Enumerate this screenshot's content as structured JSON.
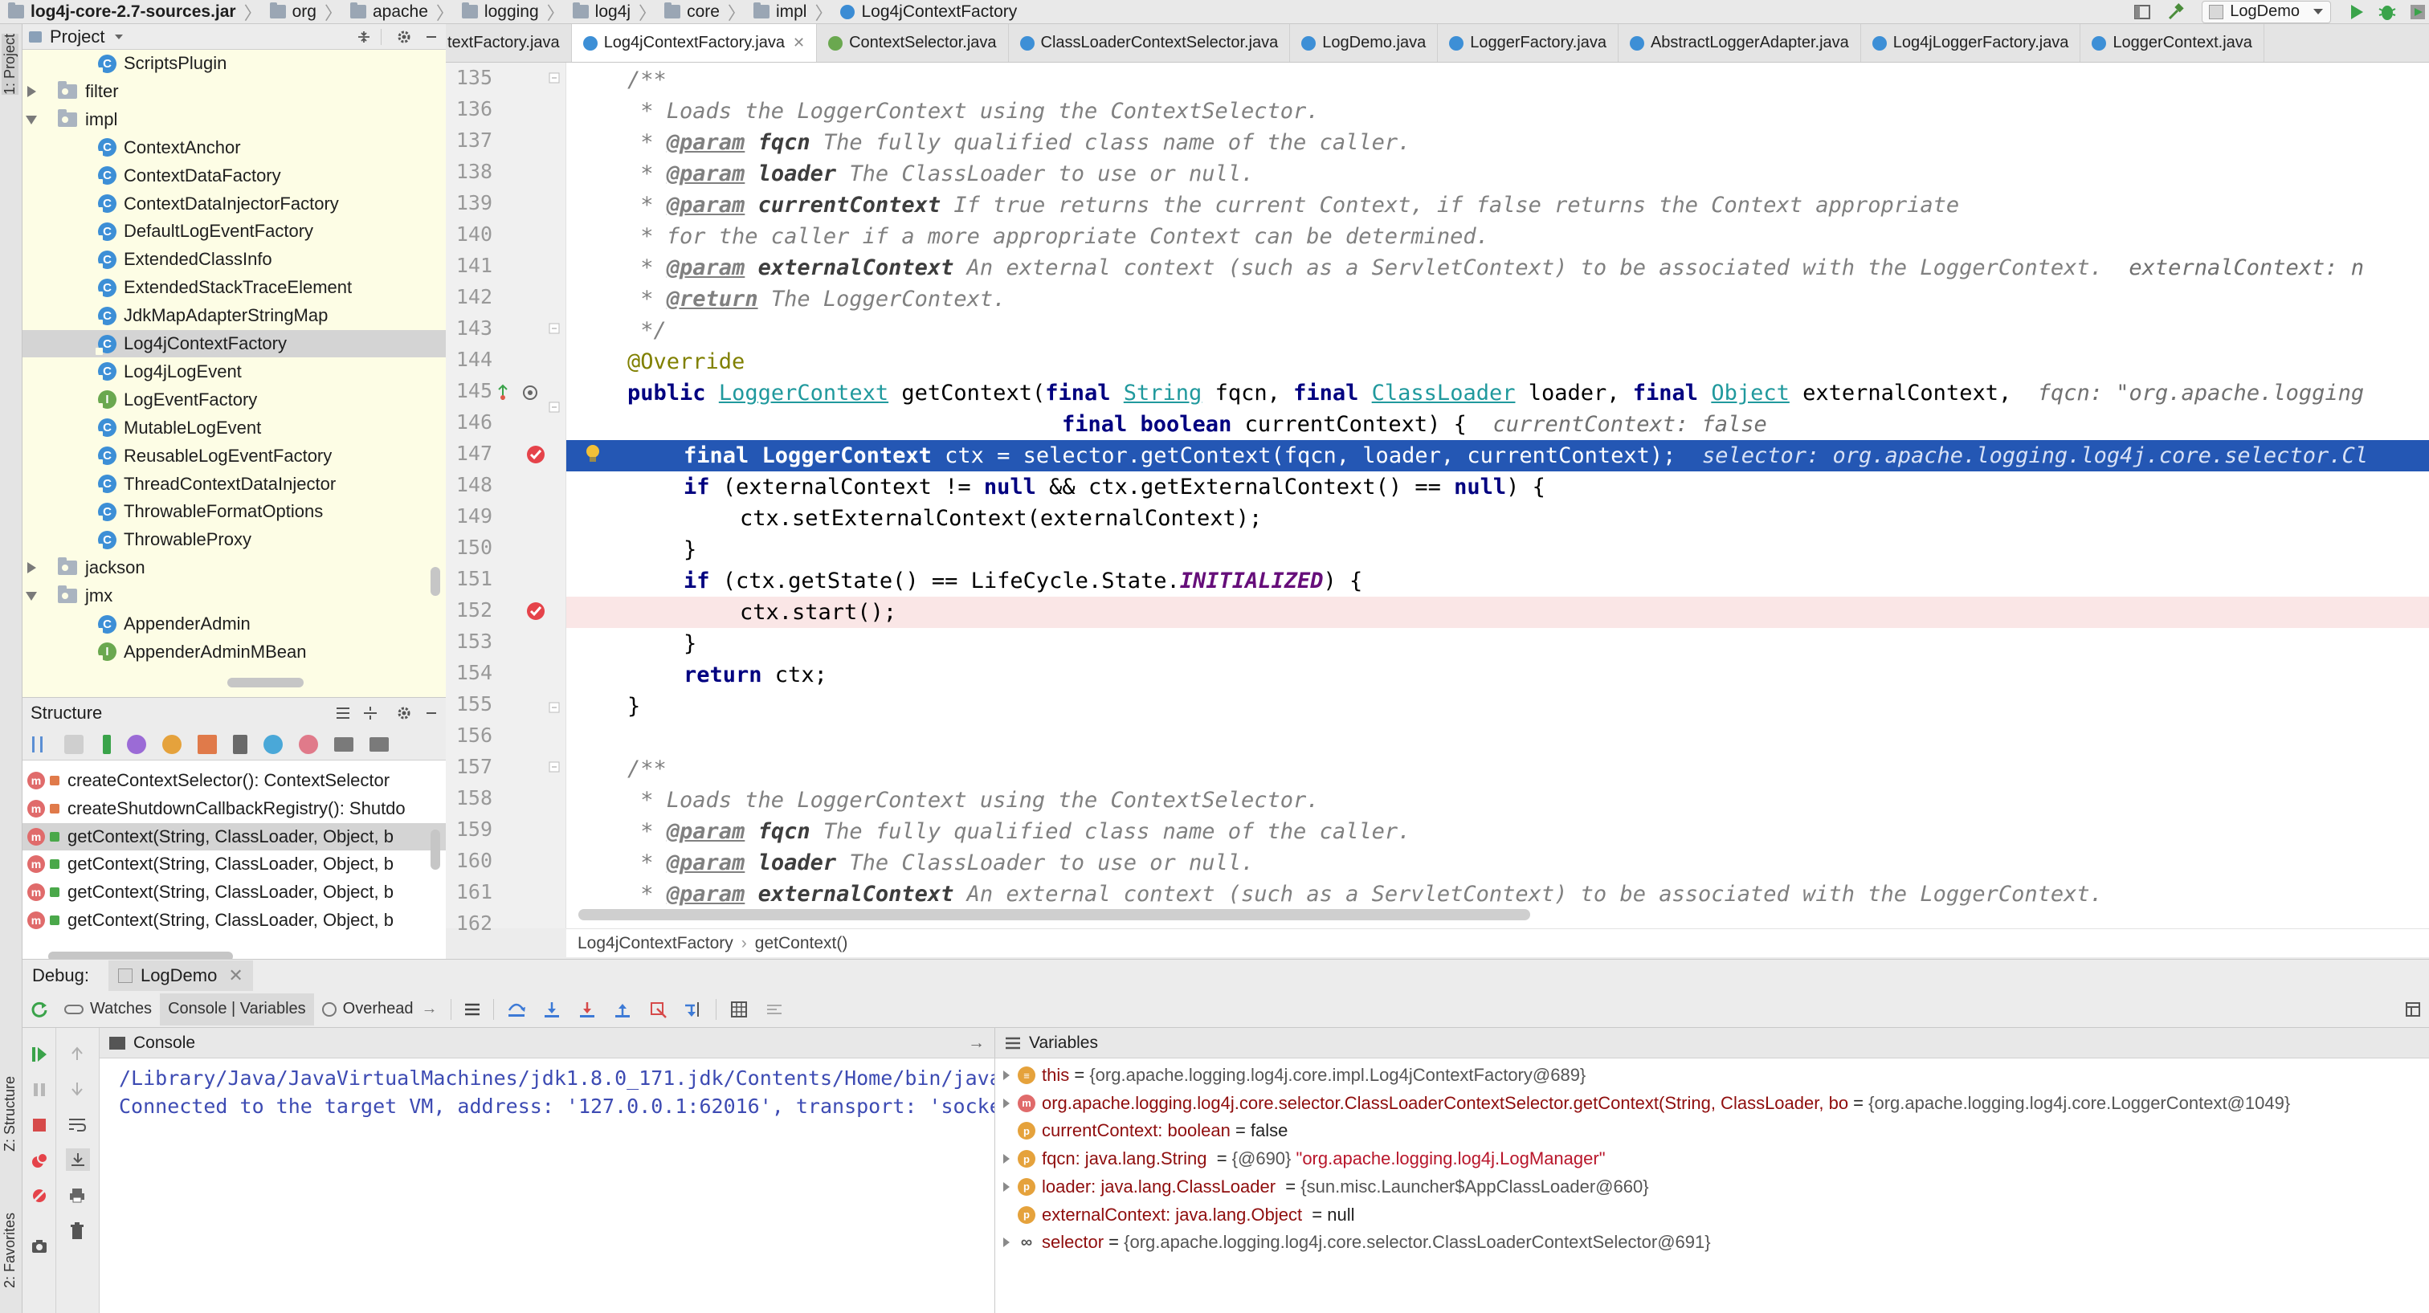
{
  "breadcrumb": [
    "log4j-core-2.7-sources.jar",
    "org",
    "apache",
    "logging",
    "log4j",
    "core",
    "impl",
    "Log4jContextFactory"
  ],
  "run_config": "LogDemo",
  "side_tabs": {
    "project": "1: Project",
    "structure": "Z: Structure",
    "favorites": "2: Favorites"
  },
  "project": {
    "title": "Project",
    "rows": [
      {
        "label": "ScriptsPlugin",
        "kind": "class"
      },
      {
        "label": "filter",
        "kind": "folder-collapsed"
      },
      {
        "label": "impl",
        "kind": "folder-expanded"
      },
      {
        "label": "ContextAnchor",
        "kind": "class"
      },
      {
        "label": "ContextDataFactory",
        "kind": "class"
      },
      {
        "label": "ContextDataInjectorFactory",
        "kind": "class"
      },
      {
        "label": "DefaultLogEventFactory",
        "kind": "class"
      },
      {
        "label": "ExtendedClassInfo",
        "kind": "class"
      },
      {
        "label": "ExtendedStackTraceElement",
        "kind": "class"
      },
      {
        "label": "JdkMapAdapterStringMap",
        "kind": "class"
      },
      {
        "label": "Log4jContextFactory",
        "kind": "class",
        "selected": true
      },
      {
        "label": "Log4jLogEvent",
        "kind": "class"
      },
      {
        "label": "LogEventFactory",
        "kind": "interface"
      },
      {
        "label": "MutableLogEvent",
        "kind": "class"
      },
      {
        "label": "ReusableLogEventFactory",
        "kind": "class"
      },
      {
        "label": "ThreadContextDataInjector",
        "kind": "class"
      },
      {
        "label": "ThrowableFormatOptions",
        "kind": "class"
      },
      {
        "label": "ThrowableProxy",
        "kind": "class"
      },
      {
        "label": "jackson",
        "kind": "folder-collapsed"
      },
      {
        "label": "jmx",
        "kind": "folder-expanded"
      },
      {
        "label": "AppenderAdmin",
        "kind": "class"
      },
      {
        "label": "AppenderAdminMBean",
        "kind": "interface"
      }
    ]
  },
  "structure": {
    "title": "Structure",
    "rows": [
      {
        "label": "createContextSelector(): ContextSelector"
      },
      {
        "label": "createShutdownCallbackRegistry(): Shutdo"
      },
      {
        "label": "getContext(String, ClassLoader, Object, b",
        "selected": true
      },
      {
        "label": "getContext(String, ClassLoader, Object, b"
      },
      {
        "label": "getContext(String, ClassLoader, Object, b"
      },
      {
        "label": "getContext(String, ClassLoader, Object, b"
      }
    ]
  },
  "tabs": [
    {
      "label": "textFactory.java",
      "kind": "class"
    },
    {
      "label": "Log4jContextFactory.java",
      "kind": "class",
      "active": true
    },
    {
      "label": "ContextSelector.java",
      "kind": "interface"
    },
    {
      "label": "ClassLoaderContextSelector.java",
      "kind": "class"
    },
    {
      "label": "LogDemo.java",
      "kind": "class"
    },
    {
      "label": "LoggerFactory.java",
      "kind": "class"
    },
    {
      "label": "AbstractLoggerAdapter.java",
      "kind": "class"
    },
    {
      "label": "Log4jLoggerFactory.java",
      "kind": "class"
    },
    {
      "label": "LoggerContext.java",
      "kind": "class"
    }
  ],
  "editor": {
    "line_numbers": [
      "135",
      "136",
      "137",
      "138",
      "139",
      "140",
      "141",
      "142",
      "143",
      "144",
      "145",
      "146",
      "147",
      "148",
      "149",
      "150",
      "151",
      "152",
      "153",
      "154",
      "155",
      "156",
      "157",
      "158",
      "159",
      "160",
      "161",
      "162"
    ],
    "breadcrumb": [
      "Log4jContextFactory",
      "getContext()"
    ],
    "text": {
      "l135": "/**",
      "l136": " * Loads the LoggerContext using the ContextSelector.",
      "l137a": " * ",
      "l137b": "@param",
      "l137c": " fqcn",
      "l137d": " The fully qualified class name of the caller.",
      "l138a": " * ",
      "l138b": "@param",
      "l138c": " loader",
      "l138d": " The ClassLoader to use or null.",
      "l139a": " * ",
      "l139b": "@param",
      "l139c": " currentContext",
      "l139d": " If true returns the current Context, if false returns the Context appropriate",
      "l140": " * for the caller if a more appropriate Context can be determined.",
      "l141a": " * ",
      "l141b": "@param",
      "l141c": " externalContext",
      "l141d": " An external context (such as a ServletContext) to be associated with the LoggerContext.",
      "l141hint": "  externalContext: n",
      "l142a": " * ",
      "l142b": "@return",
      "l142c": " The LoggerContext.",
      "l143": " */",
      "l144": "@Override",
      "l145": {
        "kw1": "public",
        "t1": "LoggerContext",
        "m": " getContext(",
        "kw2": "final",
        "t2": "String",
        "p1": " fqcn, ",
        "kw3": "final",
        "t3": "ClassLoader",
        "p2": " loader, ",
        "kw4": "final",
        "t4": "Object",
        "p3": " externalContext,",
        "hint": "  fqcn: \"org.apache.logging"
      },
      "l146": {
        "kw1": "final boolean",
        "p": " currentContext) {",
        "hint": "  currentContext: false"
      },
      "l147": {
        "kw": "final",
        "t": "LoggerContext",
        "rest": " ctx = selector.getContext(fqcn, loader, currentContext);",
        "hint": "  selector: org.apache.logging.log4j.core.selector.Cl"
      },
      "l148": {
        "kw": "if",
        "a": " (externalContext != ",
        "n1": "null",
        "b": " && ctx.",
        "m": "getExternalContext",
        "c": "() == ",
        "n2": "null",
        "d": ") {"
      },
      "l149": {
        "a": "ctx.",
        "m": "setExternalContext",
        "b": "(externalContext);"
      },
      "l150": "}",
      "l151": {
        "kw": "if",
        "a": " (ctx.",
        "m": "getState",
        "b": "() == LifeCycle.State.",
        "f": "INITIALIZED",
        "c": ") {"
      },
      "l152": {
        "a": "ctx.",
        "m": "start",
        "b": "();"
      },
      "l153": "}",
      "l154": {
        "kw": "return",
        "a": " ctx;"
      },
      "l155": "}",
      "l157": "/**",
      "l158": " * Loads the LoggerContext using the ContextSelector.",
      "l159a": " * ",
      "l159b": "@param",
      "l159c": " fqcn",
      "l159d": " The fully qualified class name of the caller.",
      "l160a": " * ",
      "l160b": "@param",
      "l160c": " loader",
      "l160d": " The ClassLoader to use or null.",
      "l161a": " * ",
      "l161b": "@param",
      "l161c": " externalContext",
      "l161d": " An external context (such as a ServletContext) to be associated with the LoggerContext."
    }
  },
  "debug": {
    "label": "Debug:",
    "session": "LogDemo",
    "tabs": {
      "watches": "Watches",
      "console_vars": "Console | Variables",
      "overhead": "Overhead"
    },
    "console_title": "Console",
    "console_lines": [
      "/Library/Java/JavaVirtualMachines/jdk1.8.0_171.jdk/Contents/Home/bin/java ...",
      "Connected to the target VM, address: '127.0.0.1:62016', transport: 'socket'"
    ],
    "variables_title": "Variables",
    "variables": [
      {
        "name": "this",
        "eq": " = ",
        "value": "{org.apache.logging.log4j.core.impl.Log4jContextFactory@689}",
        "icon": "field",
        "expandable": true
      },
      {
        "name": "org.apache.logging.log4j.core.selector.ClassLoaderContextSelector.getContext(String, ClassLoader, bo",
        "eq": " = ",
        "value": "{org.apache.logging.log4j.core.LoggerContext@1049}",
        "icon": "method-return",
        "expandable": true
      },
      {
        "name": "currentContext: boolean",
        "eq": " = ",
        "value": "false",
        "icon": "param",
        "expandable": false
      },
      {
        "name": "fqcn: java.lang.String",
        "eq": "  = ",
        "value": "{@690}",
        "extra": " \"org.apache.logging.log4j.LogManager\"",
        "icon": "param",
        "expandable": true
      },
      {
        "name": "loader: java.lang.ClassLoader",
        "eq": "  = ",
        "value": "{sun.misc.Launcher$AppClassLoader@660}",
        "icon": "param",
        "expandable": true
      },
      {
        "name": "externalContext: java.lang.Object",
        "eq": "  = ",
        "value": "null",
        "icon": "param",
        "expandable": false
      },
      {
        "name": "selector",
        "eq": " = ",
        "value": "{org.apache.logging.log4j.core.selector.ClassLoaderContextSelector@691}",
        "icon": "watch",
        "expandable": true
      }
    ]
  },
  "colors": {
    "execution_line": "#2457b4",
    "breakpoint": "#e5434a",
    "breakpoint_line": "#fae6e6",
    "project_bg": "#fdfde5",
    "class_icon": "#3d8fd6",
    "interface_icon": "#6aa84f"
  }
}
